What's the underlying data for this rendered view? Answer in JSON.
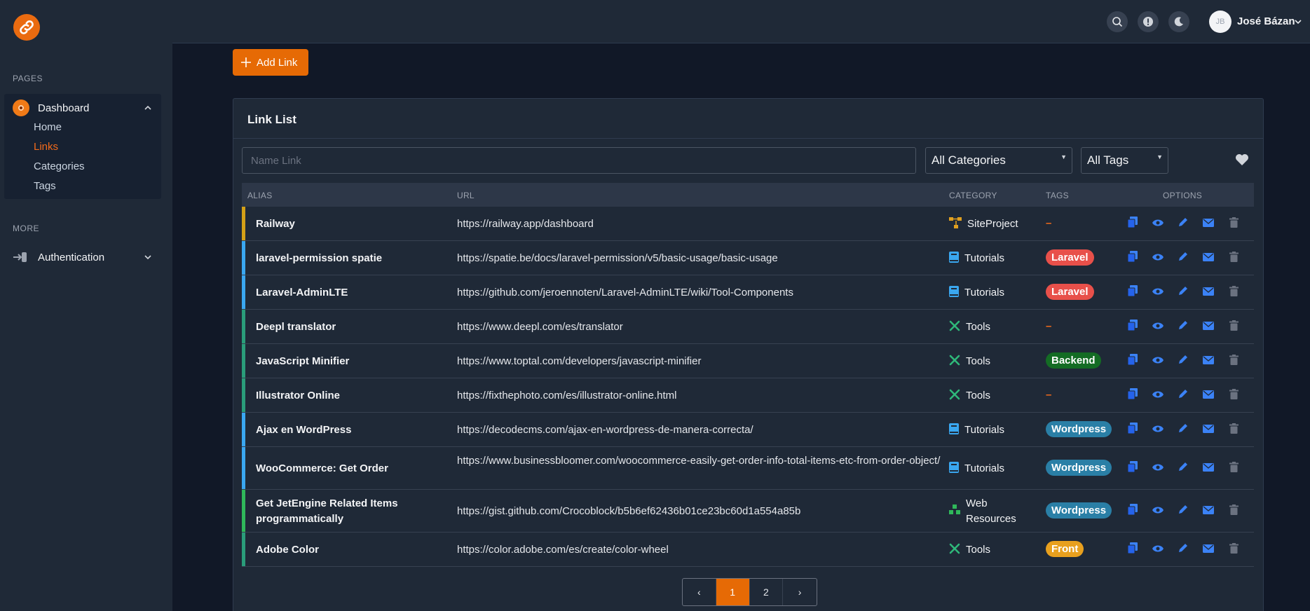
{
  "sidebar": {
    "pages_heading": "PAGES",
    "dashboard_label": "Dashboard",
    "sub_items": [
      "Home",
      "Links",
      "Categories",
      "Tags"
    ],
    "active_sub": "Links",
    "more_heading": "MORE",
    "auth_label": "Authentication"
  },
  "topbar": {
    "avatar_initials": "JB",
    "user_name": "José Bázan"
  },
  "toolbar": {
    "add_link_label": "Add Link"
  },
  "card": {
    "title": "Link List",
    "search_placeholder": "Name Link",
    "category_select": "All Categories",
    "tags_select": "All Tags"
  },
  "table": {
    "headers": {
      "alias": "ALIAS",
      "url": "URL",
      "category": "CATEGORY",
      "tags": "TAGS",
      "options": "OPTIONS"
    },
    "rows": [
      {
        "alias": "Railway",
        "url": "https://railway.app/dashboard",
        "category": "SiteProject",
        "cat_icon": "sitemap-icon",
        "tag": "–",
        "tag_color": "",
        "bar_color": "#d4a017"
      },
      {
        "alias": "laravel-permission spatie",
        "url": "https://spatie.be/docs/laravel-permission/v5/basic-usage/basic-usage",
        "category": "Tutorials",
        "cat_icon": "book-icon",
        "tag": "Laravel",
        "tag_color": "#e8504a",
        "bar_color": "#3aa7f0"
      },
      {
        "alias": "Laravel-AdminLTE",
        "url": "https://github.com/jeroennoten/Laravel-AdminLTE/wiki/Tool-Components",
        "category": "Tutorials",
        "cat_icon": "book-icon",
        "tag": "Laravel",
        "tag_color": "#e8504a",
        "bar_color": "#3aa7f0"
      },
      {
        "alias": "Deepl translator",
        "url": "https://www.deepl.com/es/translator",
        "category": "Tools",
        "cat_icon": "tools-icon",
        "tag": "–",
        "tag_color": "",
        "bar_color": "#2a9d7a"
      },
      {
        "alias": "JavaScript Minifier",
        "url": "https://www.toptal.com/developers/javascript-minifier",
        "category": "Tools",
        "cat_icon": "tools-icon",
        "tag": "Backend",
        "tag_color": "#146c24",
        "bar_color": "#2a9d7a"
      },
      {
        "alias": "Illustrator Online",
        "url": "https://fixthephoto.com/es/illustrator-online.html",
        "category": "Tools",
        "cat_icon": "tools-icon",
        "tag": "–",
        "tag_color": "",
        "bar_color": "#2a9d7a"
      },
      {
        "alias": "Ajax en WordPress",
        "url": "https://decodecms.com/ajax-en-wordpress-de-manera-correcta/",
        "category": "Tutorials",
        "cat_icon": "book-icon",
        "tag": "Wordpress",
        "tag_color": "#2a7fa6",
        "bar_color": "#3aa7f0"
      },
      {
        "alias": "WooCommerce: Get Order",
        "url": "https://www.businessbloomer.com/woocommerce-easily-get-order-info-total-items-etc-from-order-object/",
        "category": "Tutorials",
        "cat_icon": "book-icon",
        "tag": "Wordpress",
        "tag_color": "#2a7fa6",
        "bar_color": "#3aa7f0"
      },
      {
        "alias": "Get JetEngine Related Items programmatically",
        "url": "https://gist.github.com/Crocoblock/b5b6ef62436b01ce23bc60d1a554a85b",
        "category": "Web Resources",
        "cat_icon": "cubes-icon",
        "tag": "Wordpress",
        "tag_color": "#2a7fa6",
        "bar_color": "#2fb85a"
      },
      {
        "alias": "Adobe Color",
        "url": "https://color.adobe.com/es/create/color-wheel",
        "category": "Tools",
        "cat_icon": "tools-icon",
        "tag": "Front",
        "tag_color": "#e8a01e",
        "bar_color": "#2a9d7a"
      }
    ]
  },
  "pagination": {
    "prev": "‹",
    "pages": [
      "1",
      "2"
    ],
    "active": "1",
    "next": "›"
  },
  "colors": {
    "accent": "#e66a05",
    "icon_blue": "#3b82f6"
  }
}
